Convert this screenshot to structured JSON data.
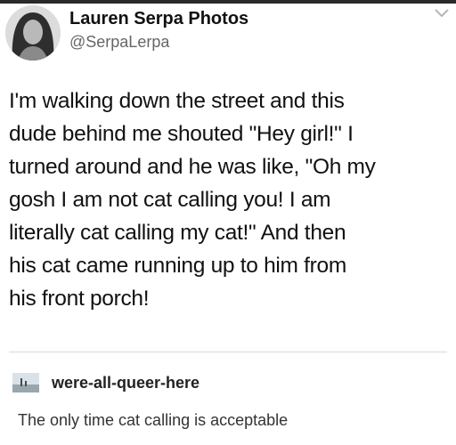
{
  "tweet": {
    "display_name": "Lauren Serpa Photos",
    "handle": "@SerpaLerpa",
    "avatar_icon": "profile-photo",
    "menu_icon": "chevron-down-icon",
    "body_lines": [
      "I'm walking down the street and this",
      "dude behind me shouted \"Hey girl!\" I",
      "turned around and he was like, \"Oh my",
      "gosh I am not cat calling you! I am",
      "literally cat calling my cat!\" And then",
      "his cat came running up to him from",
      "his front porch!"
    ]
  },
  "reblog": {
    "username": "were-all-queer-here",
    "avatar_icon": "landscape-thumbnail",
    "text": "The only time cat calling is acceptable"
  }
}
